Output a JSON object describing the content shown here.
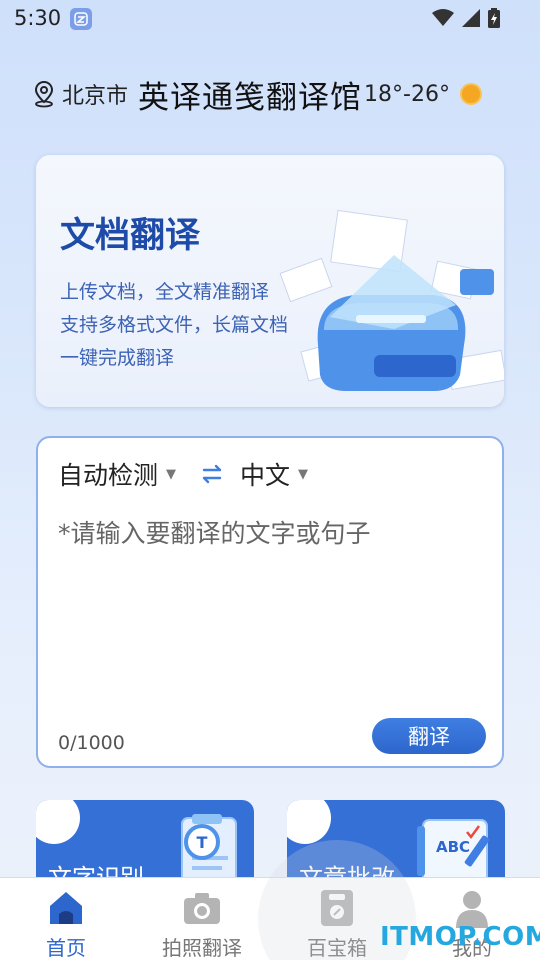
{
  "status_bar": {
    "time": "5:30",
    "icons": [
      "app-notification-icon",
      "wifi-icon",
      "signal-icon",
      "battery-icon"
    ]
  },
  "header": {
    "city": "北京市",
    "title": "英译通笺翻译馆",
    "temperature": "18°-26°"
  },
  "doc_card": {
    "title": "文档翻译",
    "lines": [
      "上传文档，全文精准翻译",
      "支持多格式文件，长篇文档",
      "一键完成翻译"
    ]
  },
  "translator": {
    "source_lang": "自动检测",
    "target_lang": "中文",
    "placeholder": "*请输入要翻译的文字或句子",
    "counter": "0/1000",
    "button": "翻译"
  },
  "features": [
    {
      "label": "文字识别"
    },
    {
      "label": "文章批改"
    }
  ],
  "tabs": [
    {
      "label": "首页",
      "icon": "home-icon",
      "active": true
    },
    {
      "label": "拍照翻译",
      "icon": "camera-icon",
      "active": false
    },
    {
      "label": "百宝箱",
      "icon": "toolbox-icon",
      "active": false
    },
    {
      "label": "我的",
      "icon": "profile-icon",
      "active": false
    }
  ],
  "watermark": "ITMOP.COM",
  "colors": {
    "accent": "#2d66cc",
    "title_blue": "#1e4aa8",
    "card_blue": "#3570d6",
    "sun": "#f5a623"
  }
}
